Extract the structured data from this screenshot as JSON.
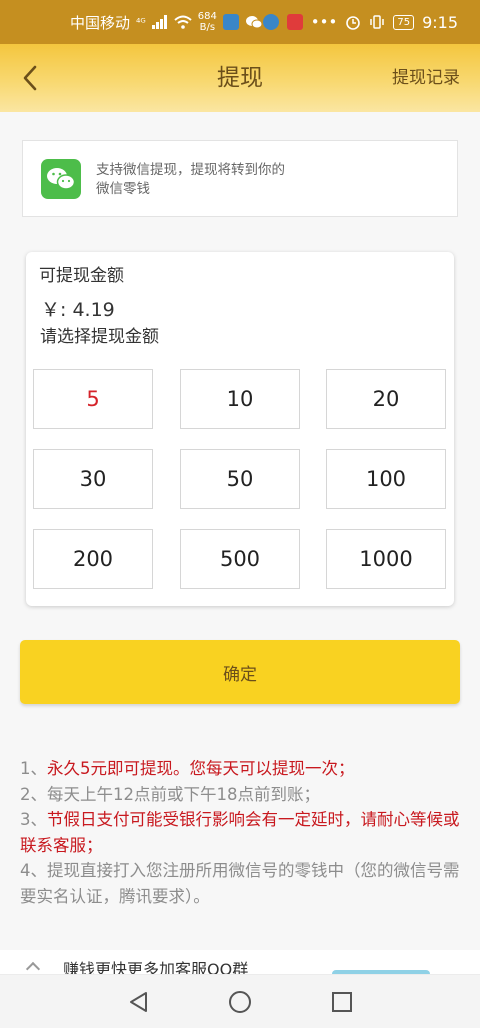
{
  "status_bar": {
    "carrier": "中国移动",
    "signal": "⁴ᴳ",
    "net_speed_value": "684",
    "net_speed_unit": "B/s",
    "battery": "75",
    "time": "9:15"
  },
  "header": {
    "title": "提现",
    "right_link": "提现记录"
  },
  "wechat_card": {
    "description": "支持微信提现，提现将转到你的微信零钱"
  },
  "amount_card": {
    "label": "可提现金额",
    "balance": "￥: 4.19",
    "prompt": "请选择提现金额",
    "options": [
      "5",
      "10",
      "20",
      "30",
      "50",
      "100",
      "200",
      "500",
      "1000"
    ],
    "selected": "5"
  },
  "confirm": {
    "label": "确定"
  },
  "notes": [
    {
      "prefix": "1、",
      "text": "永久5元即可提现。您每天可以提现一次；",
      "highlight": true
    },
    {
      "prefix": "2、",
      "text": "每天上午12点前或下午18点前到账；",
      "highlight": false
    },
    {
      "prefix": "3、",
      "text": "节假日支付可能受银行影响会有一定延时，请耐心等候或联系客服；",
      "highlight": true
    },
    {
      "prefix": "4、",
      "text": "提现直接打入您注册所用微信号的零钱中（您的微信号需要实名认证，腾讯要求）。",
      "highlight": false
    }
  ],
  "promo": {
    "text": "赚钱更快更多加客服QQ群"
  },
  "colors": {
    "status_bar": "#c58f20",
    "header_top": "#f4c63e",
    "confirm": "#f9d221",
    "highlight_red": "#c8191f",
    "selected_amount": "#d5232a",
    "wechat_green": "#4dbd4a"
  },
  "icons": {
    "back": "chevron-left-icon",
    "wechat": "wechat-icon",
    "nav_back": "triangle-back-icon",
    "nav_home": "circle-home-icon",
    "nav_recent": "square-recent-icon"
  }
}
